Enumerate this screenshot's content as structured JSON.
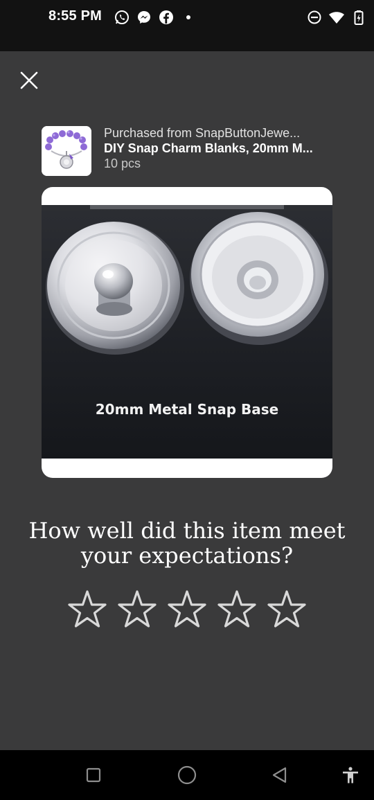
{
  "status_bar": {
    "time": "8:55 PM",
    "left_icons": [
      "whatsapp-icon",
      "messenger-icon",
      "facebook-icon",
      "notification-dot-icon"
    ],
    "right_icons": [
      "do-not-disturb-icon",
      "wifi-icon",
      "battery-charging-icon"
    ]
  },
  "header": {
    "close_icon": "close-icon"
  },
  "purchase": {
    "purchased_from": "Purchased from SnapButtonJewe...",
    "title": "DIY Snap Charm Blanks, 20mm M...",
    "quantity": "10 pcs"
  },
  "product_image": {
    "caption": "20mm Metal Snap Base"
  },
  "rating": {
    "question": "How well did this item meet your expectations?",
    "stars": [
      {
        "label": "1 star"
      },
      {
        "label": "2 stars"
      },
      {
        "label": "3 stars"
      },
      {
        "label": "4 stars"
      },
      {
        "label": "5 stars"
      }
    ],
    "selected": 0,
    "max": 5
  },
  "nav_bar": {
    "buttons": [
      "recents-button",
      "home-button",
      "back-button",
      "accessibility-button"
    ]
  },
  "colors": {
    "background": "#3a3a3b",
    "status_bar": "#121212",
    "nav_bar": "#000000",
    "star_outline": "#d9d9d9",
    "text_primary": "#ffffff"
  }
}
